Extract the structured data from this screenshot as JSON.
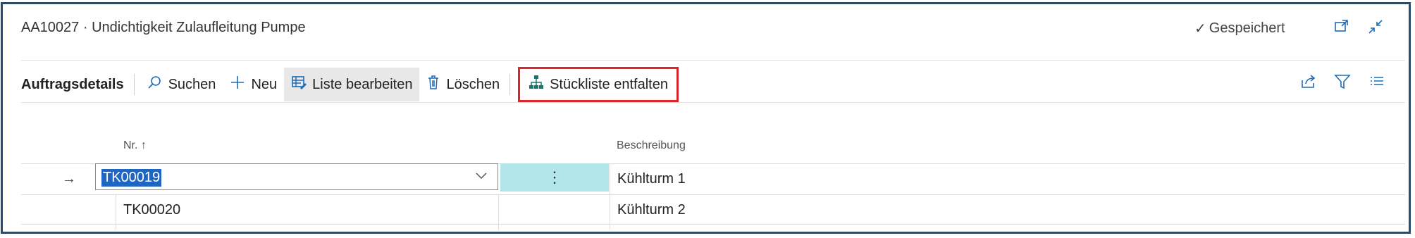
{
  "header": {
    "title": "AA10027 · Undichtigkeit Zulaufleitung Pumpe",
    "saved_label": "Gespeichert"
  },
  "toolbar": {
    "title": "Auftragsdetails",
    "search_label": "Suchen",
    "new_label": "Neu",
    "edit_list_label": "Liste bearbeiten",
    "delete_label": "Löschen",
    "explode_bom_label": "Stückliste entfalten"
  },
  "table": {
    "columns": {
      "nr": "Nr. ↑",
      "description": "Beschreibung"
    },
    "rows": [
      {
        "nr": "TK00019",
        "description": "Kühlturm 1"
      },
      {
        "nr": "TK00020",
        "description": "Kühlturm 2"
      }
    ]
  },
  "icons": {
    "check": "check-icon",
    "open_new": "open-in-new-icon",
    "collapse": "collapse-icon",
    "search": "search-icon",
    "plus": "plus-icon",
    "edit_list": "edit-list-icon",
    "trash": "trash-icon",
    "bom": "bom-tree-icon",
    "share": "share-icon",
    "filter": "filter-icon",
    "list": "list-icon",
    "arrow": "row-arrow-icon"
  },
  "colors": {
    "accent": "#1f6bb8",
    "highlight_red": "#d9262c",
    "selection": "#1f66c2",
    "cell_focus": "#b3e6ea",
    "frame": "#1f4e79"
  }
}
